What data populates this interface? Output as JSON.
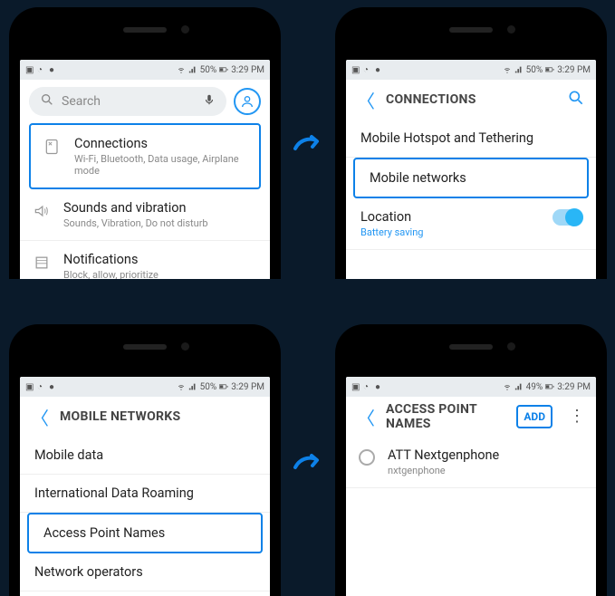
{
  "statusbar": {
    "battery": "50%",
    "battery2": "49%",
    "time": "3:29 PM"
  },
  "screen1": {
    "search_placeholder": "Search",
    "items": [
      {
        "title": "Connections",
        "sub": "Wi-Fi, Bluetooth, Data usage, Airplane mode"
      },
      {
        "title": "Sounds and vibration",
        "sub": "Sounds, Vibration, Do not disturb"
      },
      {
        "title": "Notifications",
        "sub": "Block, allow, prioritize"
      }
    ]
  },
  "screen2": {
    "header": "CONNECTIONS",
    "items": [
      {
        "title": "Mobile Hotspot and Tethering"
      },
      {
        "title": "Mobile networks"
      },
      {
        "title": "Location",
        "sub": "Battery saving"
      }
    ]
  },
  "screen3": {
    "header": "MOBILE NETWORKS",
    "items": [
      {
        "title": "Mobile data"
      },
      {
        "title": "International Data Roaming"
      },
      {
        "title": "Access Point Names"
      },
      {
        "title": "Network operators"
      }
    ]
  },
  "screen4": {
    "header": "ACCESS POINT NAMES",
    "add": "ADD",
    "items": [
      {
        "title": "ATT Nextgenphone",
        "sub": "nxtgenphone"
      }
    ]
  }
}
